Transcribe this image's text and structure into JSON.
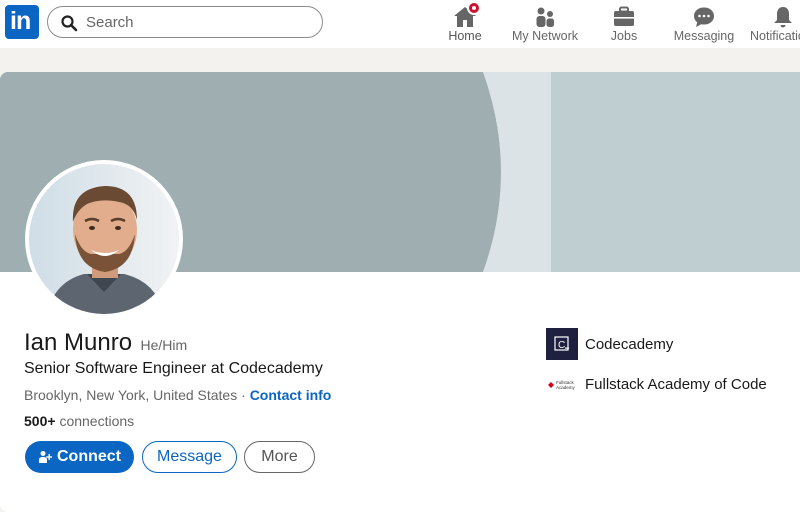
{
  "nav": {
    "search_placeholder": "Search",
    "items": [
      {
        "label": "Home",
        "icon": "home-icon",
        "notification": true
      },
      {
        "label": "My Network",
        "icon": "my-network-icon"
      },
      {
        "label": "Jobs",
        "icon": "jobs-icon"
      },
      {
        "label": "Messaging",
        "icon": "messaging-icon"
      },
      {
        "label": "Notifications",
        "icon": "notifications-icon"
      }
    ]
  },
  "profile": {
    "name": "Ian Munro",
    "pronouns": "He/Him",
    "headline": "Senior Software Engineer at Codecademy",
    "location": "Brooklyn, New York, United States",
    "separator": "·",
    "contact_info": "Contact info",
    "connections_count": "500+",
    "connections_label": "connections"
  },
  "actions": {
    "connect": "Connect",
    "message": "Message",
    "more": "More"
  },
  "experience": [
    {
      "name": "Codecademy",
      "logo": "C_"
    },
    {
      "name": "Fullstack Academy of Code",
      "logo": "Fullstack Academy"
    }
  ],
  "colors": {
    "brand": "#0a66c2",
    "banner_left": "#9eaeb1",
    "banner_right": "#bfcfd1",
    "badge": "#cb112d"
  }
}
